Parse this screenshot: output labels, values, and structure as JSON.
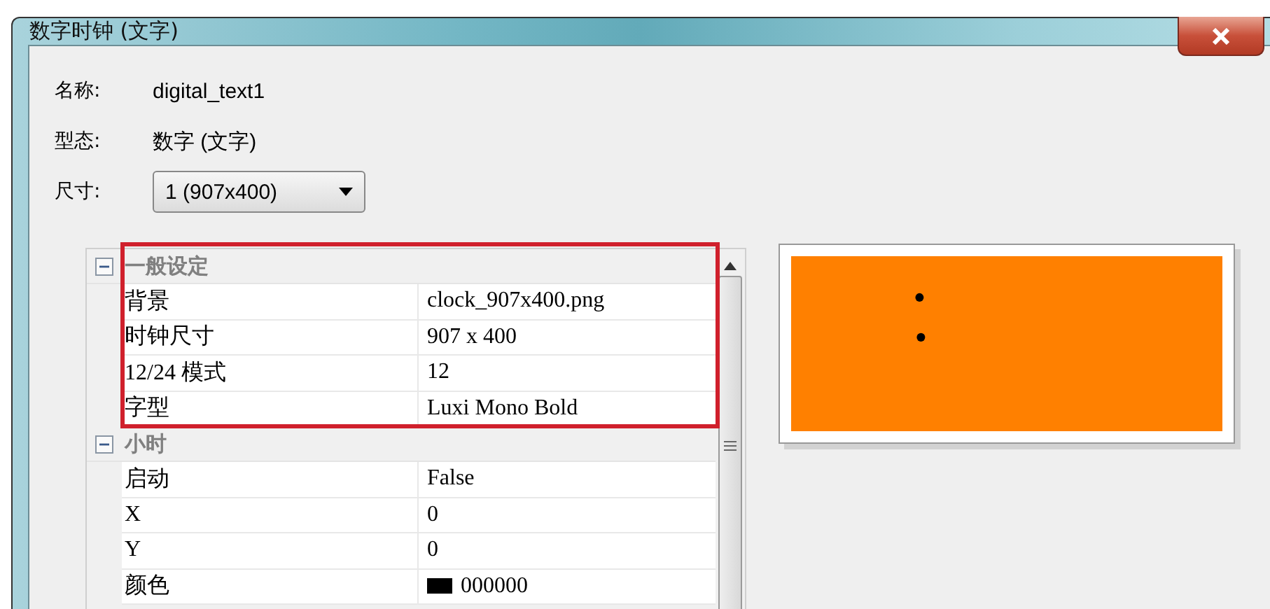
{
  "window": {
    "title": "数字时钟 (文字)"
  },
  "fields": [
    {
      "kind": "text",
      "label": "名称:",
      "value": "digital_text1"
    },
    {
      "kind": "text",
      "label": "型态:",
      "value": "数字 (文字)"
    },
    {
      "kind": "dropdown",
      "label": "尺寸:",
      "value": "1  (907x400)"
    }
  ],
  "property_grid": {
    "categories": [
      {
        "name": "一般设定",
        "expanded": true,
        "highlighted": true,
        "rows": [
          {
            "kind": "text",
            "name": "背景",
            "value": "clock_907x400.png"
          },
          {
            "kind": "text",
            "name": "时钟尺寸",
            "value": "907 x 400"
          },
          {
            "kind": "text",
            "name": "12/24 模式",
            "value": "12"
          },
          {
            "kind": "text",
            "name": "字型",
            "value": "Luxi Mono Bold"
          }
        ]
      },
      {
        "name": "小时",
        "expanded": true,
        "highlighted": false,
        "rows": [
          {
            "kind": "text",
            "name": "启动",
            "value": "False"
          },
          {
            "kind": "text",
            "name": "X",
            "value": "0"
          },
          {
            "kind": "text",
            "name": "Y",
            "value": "0"
          },
          {
            "kind": "color",
            "name": "颜色",
            "value": "000000",
            "color": "#000000"
          }
        ]
      }
    ]
  },
  "preview": {
    "color": "#ff8000"
  }
}
